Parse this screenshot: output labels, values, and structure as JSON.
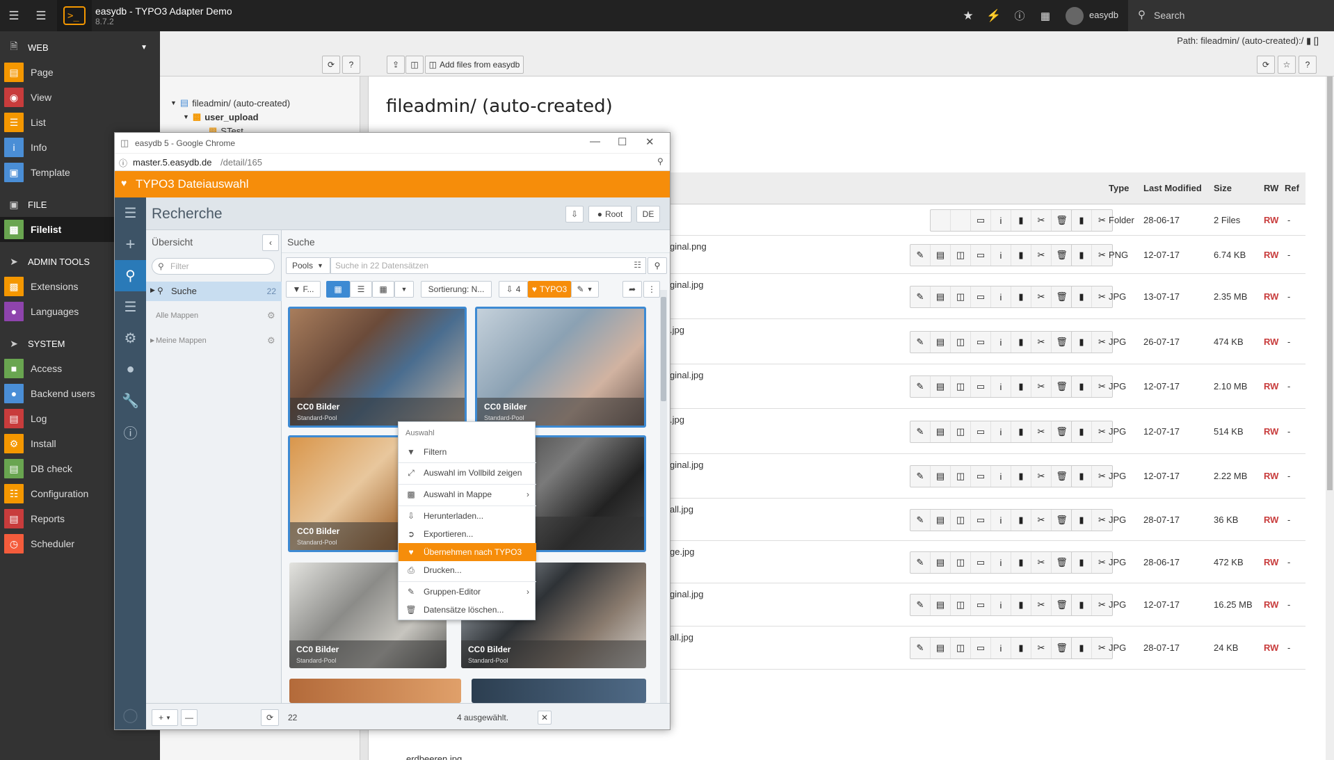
{
  "topbar": {
    "site_title": "easydb - TYPO3 Adapter Demo",
    "site_version": "8.7.2",
    "user_name": "easydb",
    "search_label": "Search",
    "logo_glyph": ">_"
  },
  "modmenu": {
    "groups": [
      {
        "label": "WEB",
        "icon": "document-icon"
      },
      {
        "label": "FILE",
        "icon": "image-icon"
      },
      {
        "label": "ADMIN TOOLS",
        "icon": "rocket-icon"
      },
      {
        "label": "SYSTEM",
        "icon": "rocket-icon"
      }
    ],
    "items": [
      {
        "label": "Page",
        "color": "#f49700"
      },
      {
        "label": "View",
        "color": "#c83c3c"
      },
      {
        "label": "List",
        "color": "#f49700"
      },
      {
        "label": "Info",
        "color": "#4a8ed6"
      },
      {
        "label": "Template",
        "color": "#4a8ed6"
      },
      {
        "label": "Filelist",
        "color": "#69a550"
      },
      {
        "label": "Extensions",
        "color": "#f49700"
      },
      {
        "label": "Languages",
        "color": "#8e44ad"
      },
      {
        "label": "Access",
        "color": "#69a550"
      },
      {
        "label": "Backend users",
        "color": "#4a8ed6"
      },
      {
        "label": "Log",
        "color": "#c83c3c"
      },
      {
        "label": "Install",
        "color": "#f49700"
      },
      {
        "label": "DB check",
        "color": "#69a550"
      },
      {
        "label": "Configuration",
        "color": "#f49700"
      },
      {
        "label": "Reports",
        "color": "#c83c3c"
      },
      {
        "label": "Scheduler",
        "color": "#f45c3c"
      }
    ]
  },
  "docheader": {
    "path_label": "Path: fileadmin/ (auto-created):/",
    "add_files_label": "Add files from easydb",
    "help_label": "?"
  },
  "tree": {
    "root_label": "fileadmin/ (auto-created)",
    "child_label": "user_upload",
    "grandchild_label": "STest"
  },
  "content": {
    "page_title": "fileadmin/ (auto-created)",
    "columns": [
      "Type",
      "Last Modified",
      "Size",
      "RW",
      "Ref"
    ],
    "rows": [
      {
        "name": "",
        "type": "Folder",
        "modified": "28-06-17",
        "size": "2 Files",
        "rw": "RW",
        "ref": "-"
      },
      {
        "name": "ginal.png",
        "type": "PNG",
        "modified": "12-07-17",
        "size": "6.74 KB",
        "rw": "RW",
        "ref": "-"
      },
      {
        "name": "ginal.jpg",
        "type": "JPG",
        "modified": "13-07-17",
        "size": "2.35 MB",
        "rw": "RW",
        "ref": "-"
      },
      {
        "name": ".jpg",
        "type": "JPG",
        "modified": "26-07-17",
        "size": "474 KB",
        "rw": "RW",
        "ref": "-"
      },
      {
        "name": "ginal.jpg",
        "type": "JPG",
        "modified": "12-07-17",
        "size": "2.10 MB",
        "rw": "RW",
        "ref": "-"
      },
      {
        "name": ".jpg",
        "type": "JPG",
        "modified": "12-07-17",
        "size": "514 KB",
        "rw": "RW",
        "ref": "-"
      },
      {
        "name": "ginal.jpg",
        "type": "JPG",
        "modified": "12-07-17",
        "size": "2.22 MB",
        "rw": "RW",
        "ref": "-"
      },
      {
        "name": "all.jpg",
        "type": "JPG",
        "modified": "28-07-17",
        "size": "36 KB",
        "rw": "RW",
        "ref": "-"
      },
      {
        "name": "ge.jpg",
        "type": "JPG",
        "modified": "28-06-17",
        "size": "472 KB",
        "rw": "RW",
        "ref": "-"
      },
      {
        "name": "ginal.jpg",
        "type": "JPG",
        "modified": "12-07-17",
        "size": "16.25 MB",
        "rw": "RW",
        "ref": "-"
      },
      {
        "name": "all.jpg",
        "type": "JPG",
        "modified": "28-07-17",
        "size": "24 KB",
        "rw": "RW",
        "ref": "-"
      }
    ],
    "last_row_name": "erdbeeren.jpg"
  },
  "popup": {
    "window_title": "easydb 5 - Google Chrome",
    "url_host": "master.5.easydb.de",
    "url_path": "/detail/165",
    "app_title": "TYPO3 Dateiauswahl",
    "header_title": "Recherche",
    "root_button": "Root",
    "lang_button": "DE",
    "side_title": "Übersicht",
    "filter_placeholder": "Filter",
    "search_item": "Suche",
    "search_count": "22",
    "all_folders": "Alle Mappen",
    "my_folders": "Meine Mappen",
    "main_title": "Suche",
    "pools_label": "Pools",
    "search_placeholder": "Suche in 22 Datensätzen",
    "filter_btn": "F...",
    "sort_label": "Sortierung: N...",
    "download_count": "4",
    "typo3_label": "TYPO3",
    "tiles": [
      {
        "title": "CC0 Bilder",
        "pool": "Standard-Pool"
      },
      {
        "title": "CC0 Bilder",
        "pool": "Standard-Pool"
      },
      {
        "title": "CC0 Bilder",
        "pool": "Standard-Pool"
      },
      {
        "title": "",
        "pool": ""
      },
      {
        "title": "CC0 Bilder",
        "pool": "Standard-Pool"
      },
      {
        "title": "CC0 Bilder",
        "pool": "Standard-Pool"
      }
    ],
    "footer_count": "22",
    "footer_selected": "4 ausgewählt."
  },
  "context_menu": {
    "heading": "Auswahl",
    "items": [
      {
        "label": "Filtern",
        "icon": "filter-icon"
      },
      {
        "label": "Auswahl im Vollbild zeigen",
        "icon": "fullscreen-icon"
      },
      {
        "label": "Auswahl in Mappe",
        "icon": "folder-open-icon"
      },
      {
        "label": "Herunterladen...",
        "icon": "download-icon"
      },
      {
        "label": "Exportieren...",
        "icon": "export-icon"
      },
      {
        "label": "Übernehmen nach TYPO3",
        "icon": "typo3-icon"
      },
      {
        "label": "Drucken...",
        "icon": "print-icon"
      },
      {
        "label": "Gruppen-Editor",
        "icon": "pencil-icon"
      },
      {
        "label": "Datensätze löschen...",
        "icon": "trash-icon"
      }
    ]
  }
}
